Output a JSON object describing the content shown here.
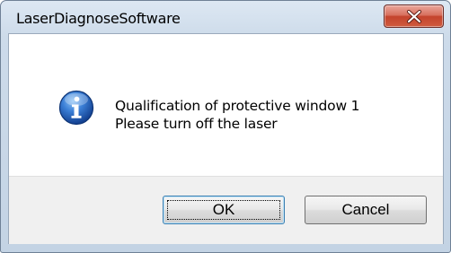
{
  "window": {
    "title": "LaserDiagnoseSoftware",
    "close_icon": "close-icon"
  },
  "message": {
    "icon": "information-icon",
    "line1": "Qualification of protective window 1",
    "line2": "Please turn off the laser"
  },
  "buttons": {
    "ok_label": "OK",
    "cancel_label": "Cancel"
  },
  "colors": {
    "close_button": "#c4432d",
    "info_icon": "#1f5fb8",
    "default_button_border": "#3c7fb1"
  }
}
